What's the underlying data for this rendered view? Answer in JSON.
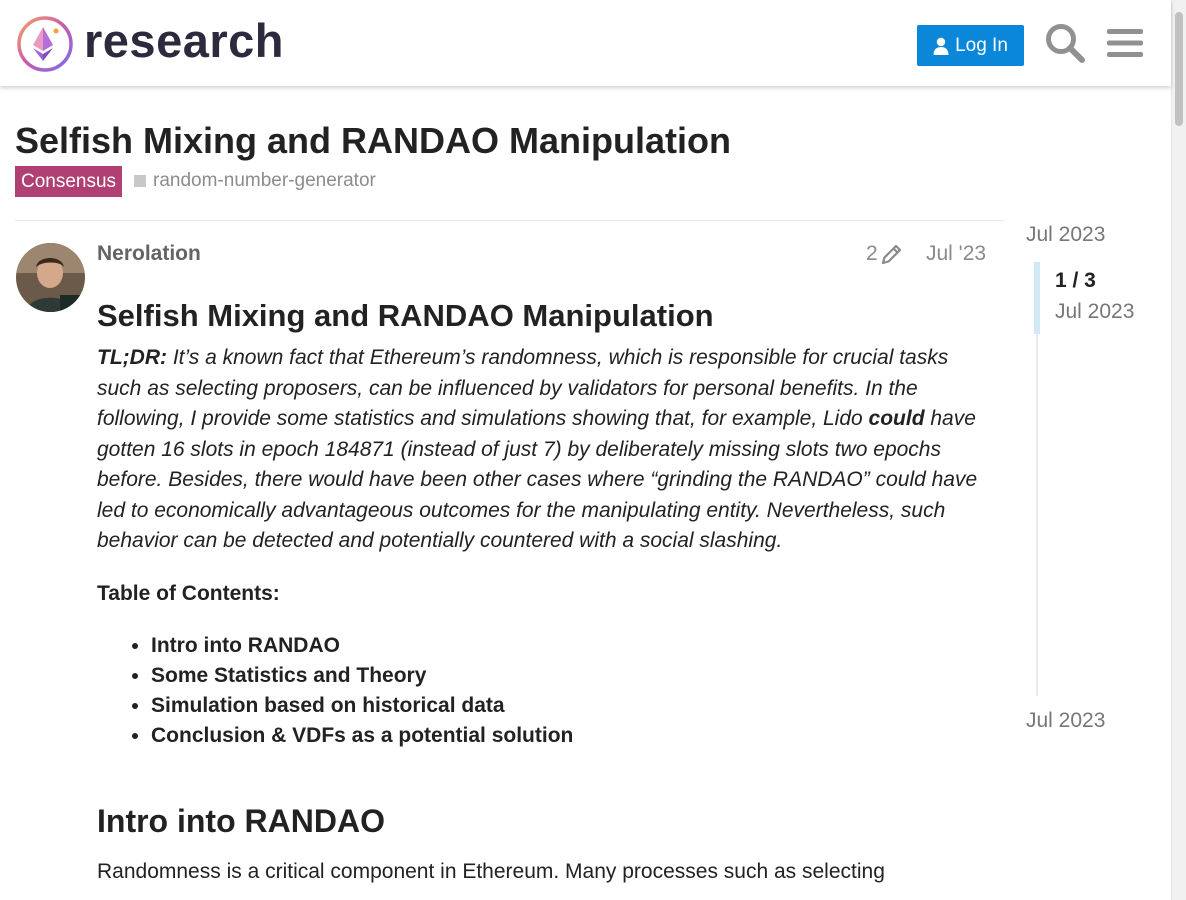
{
  "header": {
    "site_name": "research",
    "login_label": "Log In"
  },
  "topic": {
    "title": "Selfish Mixing and RANDAO Manipulation",
    "category": "Consensus",
    "category_color": "#b03f73",
    "tag": "random-number-generator"
  },
  "post": {
    "username": "Nerolation",
    "edit_count": "2",
    "date": "Jul '23",
    "heading": "Selfish Mixing and RANDAO Manipulation",
    "tldr_label": "TL;DR:",
    "tldr_part1": " It’s a known fact that Ethereum’s randomness, which is responsible for crucial tasks such as selecting proposers, can be influenced by validators for personal benefits. In the following, I provide some statistics and simulations showing that, for example, Lido ",
    "tldr_bold": "could",
    "tldr_part2": " have gotten 16 slots in epoch 184871 (instead of just 7) by deliberately missing slots two epochs before. Besides, there would have been other cases where “grinding the RANDAO” could have led to economically advantageous outcomes for the manipulating entity. Nevertheless, such behavior can be detected and potentially countered with a social slashing.",
    "toc_title": "Table of Contents:",
    "toc_items": [
      "Intro into RANDAO",
      "Some Statistics and Theory",
      "Simulation based on historical data",
      "Conclusion & VDFs as a potential solution"
    ],
    "section_heading": "Intro into RANDAO",
    "section_text": "Randomness is a critical component in Ethereum. Many processes such as selecting"
  },
  "timeline": {
    "top_date": "Jul 2023",
    "counter": "1 / 3",
    "handle_date": "Jul 2023",
    "bottom_date": "Jul 2023"
  },
  "colors": {
    "accent": "#0a87d8",
    "timeline_handle": "#d1e8f6"
  },
  "icons": {
    "logo": "ethereum-research-logo",
    "login": "user-icon",
    "search": "search-icon",
    "menu": "hamburger-menu-icon",
    "edit": "pencil-icon"
  }
}
